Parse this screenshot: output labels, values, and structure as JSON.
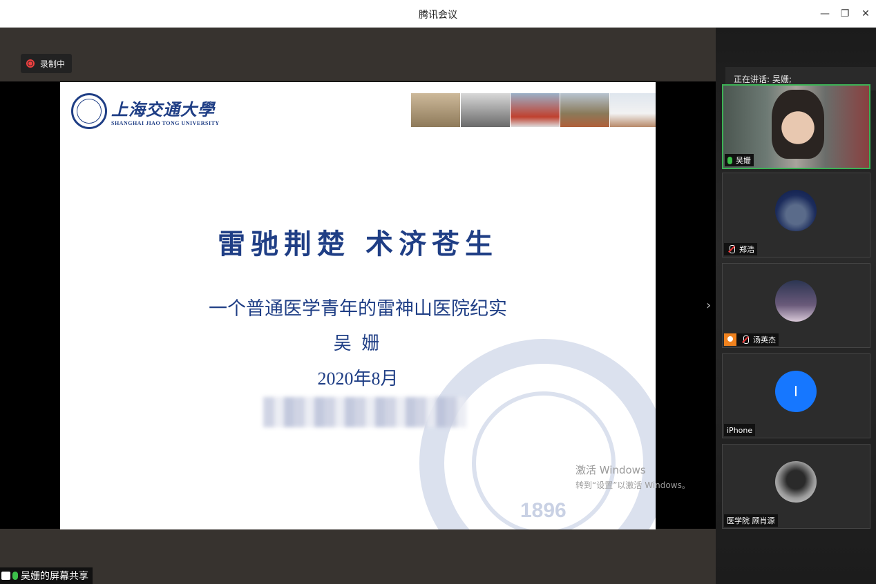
{
  "window": {
    "title": "腾讯会议"
  },
  "recording": {
    "label": "录制中"
  },
  "slide": {
    "logo_cn": "上海交通大學",
    "logo_en": "SHANGHAI JIAO TONG UNIVERSITY",
    "seal_year": "1896",
    "title": "雷驰荆楚 术济苍生",
    "subtitle": "一个普通医学青年的雷神山医院纪实",
    "author": "吴 姗",
    "date": "2020年8月"
  },
  "watermark": {
    "line1": "激活 Windows",
    "line2": "转到“设置”以激活 Windows。"
  },
  "share_label": "吴姗的屏幕共享",
  "speaking": "正在讲话: 吴姗;",
  "participants": [
    {
      "name": "吴姗"
    },
    {
      "name": "郑浩"
    },
    {
      "name": "汤英杰"
    },
    {
      "name": "iPhone",
      "initial": "I"
    },
    {
      "name": "医学院 顾肖源"
    }
  ],
  "colors": {
    "accent": "#1f3e85",
    "active_border": "#3cb255",
    "avatar_blue": "#1677ff"
  }
}
